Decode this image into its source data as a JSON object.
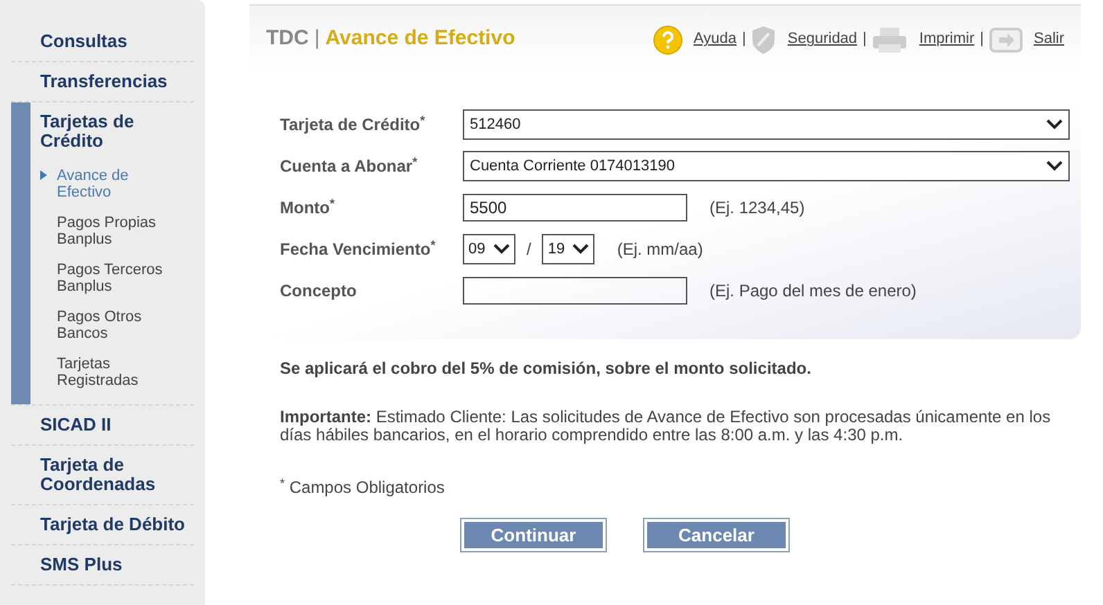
{
  "sidebar": {
    "items": [
      {
        "label": "Consultas",
        "expanded": false
      },
      {
        "label": "Transferencias",
        "expanded": false
      },
      {
        "label": "Tarjetas de Crédito",
        "expanded": true,
        "children": [
          {
            "label": "Avance de Efectivo",
            "selected": true
          },
          {
            "label": "Pagos Propias Banplus",
            "selected": false
          },
          {
            "label": "Pagos Terceros Banplus",
            "selected": false
          },
          {
            "label": "Pagos Otros Bancos",
            "selected": false
          },
          {
            "label": "Tarjetas Registradas",
            "selected": false
          }
        ]
      },
      {
        "label": "SICAD II",
        "expanded": false
      },
      {
        "label": "Tarjeta de Coordenadas",
        "expanded": false
      },
      {
        "label": "Tarjeta de Débito",
        "expanded": false
      },
      {
        "label": "SMS Plus",
        "expanded": false
      }
    ]
  },
  "header": {
    "section": "TDC",
    "separator": "|",
    "title": "Avance de Efectivo",
    "links": [
      {
        "label": "Ayuda",
        "kind": "help",
        "sep": "|"
      },
      {
        "label": "Seguridad",
        "kind": "shield",
        "sep": "|"
      },
      {
        "label": "Imprimir",
        "kind": "printer",
        "sep": "|"
      },
      {
        "label": "Salir",
        "kind": "exit"
      }
    ]
  },
  "form": {
    "fields": [
      {
        "kind": "select",
        "label": "Tarjeta de Crédito$^{*}$",
        "value": "512460"
      },
      {
        "kind": "select",
        "label": "Cuenta a Abonar$^{*}$",
        "value": "Cuenta Corriente 0174013190"
      },
      {
        "kind": "input",
        "label": "Monto$^{*}$",
        "value": "5500",
        "hint": "(Ej. 1234,45)"
      },
      {
        "kind": "date",
        "label": "Fecha Vencimiento$^{*}$",
        "month": "09",
        "separator": "/",
        "year": "19",
        "hint": "(Ej. mm/aa)"
      },
      {
        "kind": "input",
        "label": "Concepto",
        "hint": "(Ej. Pago del mes de enero)"
      }
    ]
  },
  "commission_note": "Se aplicará el cobro del 5% de comisión, sobre el monto solicitado.",
  "important_note": "**Importante:** Estimado Cliente: Las solicitudes de Avance de Efectivo son procesadas únicamente en los días hábiles bancarios, en el horario comprendido entre las 8:00 a.m. y las 4:30 p.m.",
  "required_note": "$^{*}$ Campos Obligatorios",
  "buttons": [
    "Continuar",
    "Cancelar"
  ]
}
